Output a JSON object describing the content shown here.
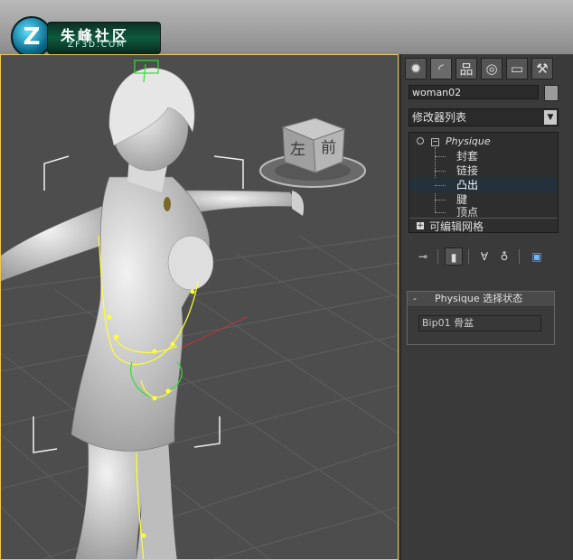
{
  "logo": {
    "mark": "Z",
    "title": "朱峰社区",
    "subtitle": "ZF3D.COM"
  },
  "viewport": {
    "view_cube": {
      "left_label": "左",
      "front_label": "前"
    }
  },
  "command_panel": {
    "tabs": [
      {
        "name": "create-tab-icon",
        "glyph": "✹"
      },
      {
        "name": "modify-tab-icon",
        "glyph": "◜"
      },
      {
        "name": "hierarchy-tab-icon",
        "glyph": "品"
      },
      {
        "name": "motion-tab-icon",
        "glyph": "◎"
      },
      {
        "name": "display-tab-icon",
        "glyph": "▭"
      },
      {
        "name": "utilities-tab-icon",
        "glyph": "⚒"
      }
    ],
    "object_name": "woman02",
    "modifier_list_label": "修改器列表",
    "stack": {
      "physique_label": "Physique",
      "sub_items": [
        "封套",
        "链接",
        "凸出",
        "腱",
        "顶点"
      ],
      "selected_index": 2,
      "editable_mesh_label": "可编辑网格"
    },
    "rollout": {
      "toggle": "-",
      "title": "Physique 选择状态",
      "selection_value": "Bip01 骨盆"
    }
  },
  "colors": {
    "viewport_border": "#f1c84a",
    "selected_row": "#23313b",
    "skeleton": "#ffff33",
    "ik_green": "#30e030"
  }
}
